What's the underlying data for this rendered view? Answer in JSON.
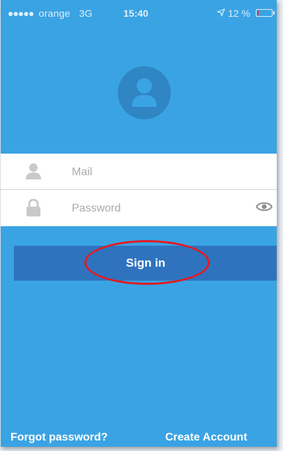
{
  "status_bar": {
    "signal_dots": "●●●●●",
    "carrier": "orange",
    "network": "3G",
    "time": "15:40",
    "location_icon": "location-arrow-icon",
    "battery_percent": "12 %",
    "battery_level": 0.12,
    "battery_color": "#e53935"
  },
  "avatar": {
    "icon": "user-avatar-icon"
  },
  "form": {
    "mail": {
      "placeholder": "Mail",
      "value": "",
      "icon": "user-icon"
    },
    "password": {
      "placeholder": "Password",
      "value": "",
      "icon": "lock-icon",
      "toggle_icon": "eye-icon"
    }
  },
  "signin": {
    "label": "Sign in"
  },
  "footer": {
    "forgot_label": "Forgot password?",
    "create_label": "Create Account"
  },
  "colors": {
    "background": "#3aa3e3",
    "button": "#2f73bf",
    "highlight_ring": "#e21b23"
  }
}
